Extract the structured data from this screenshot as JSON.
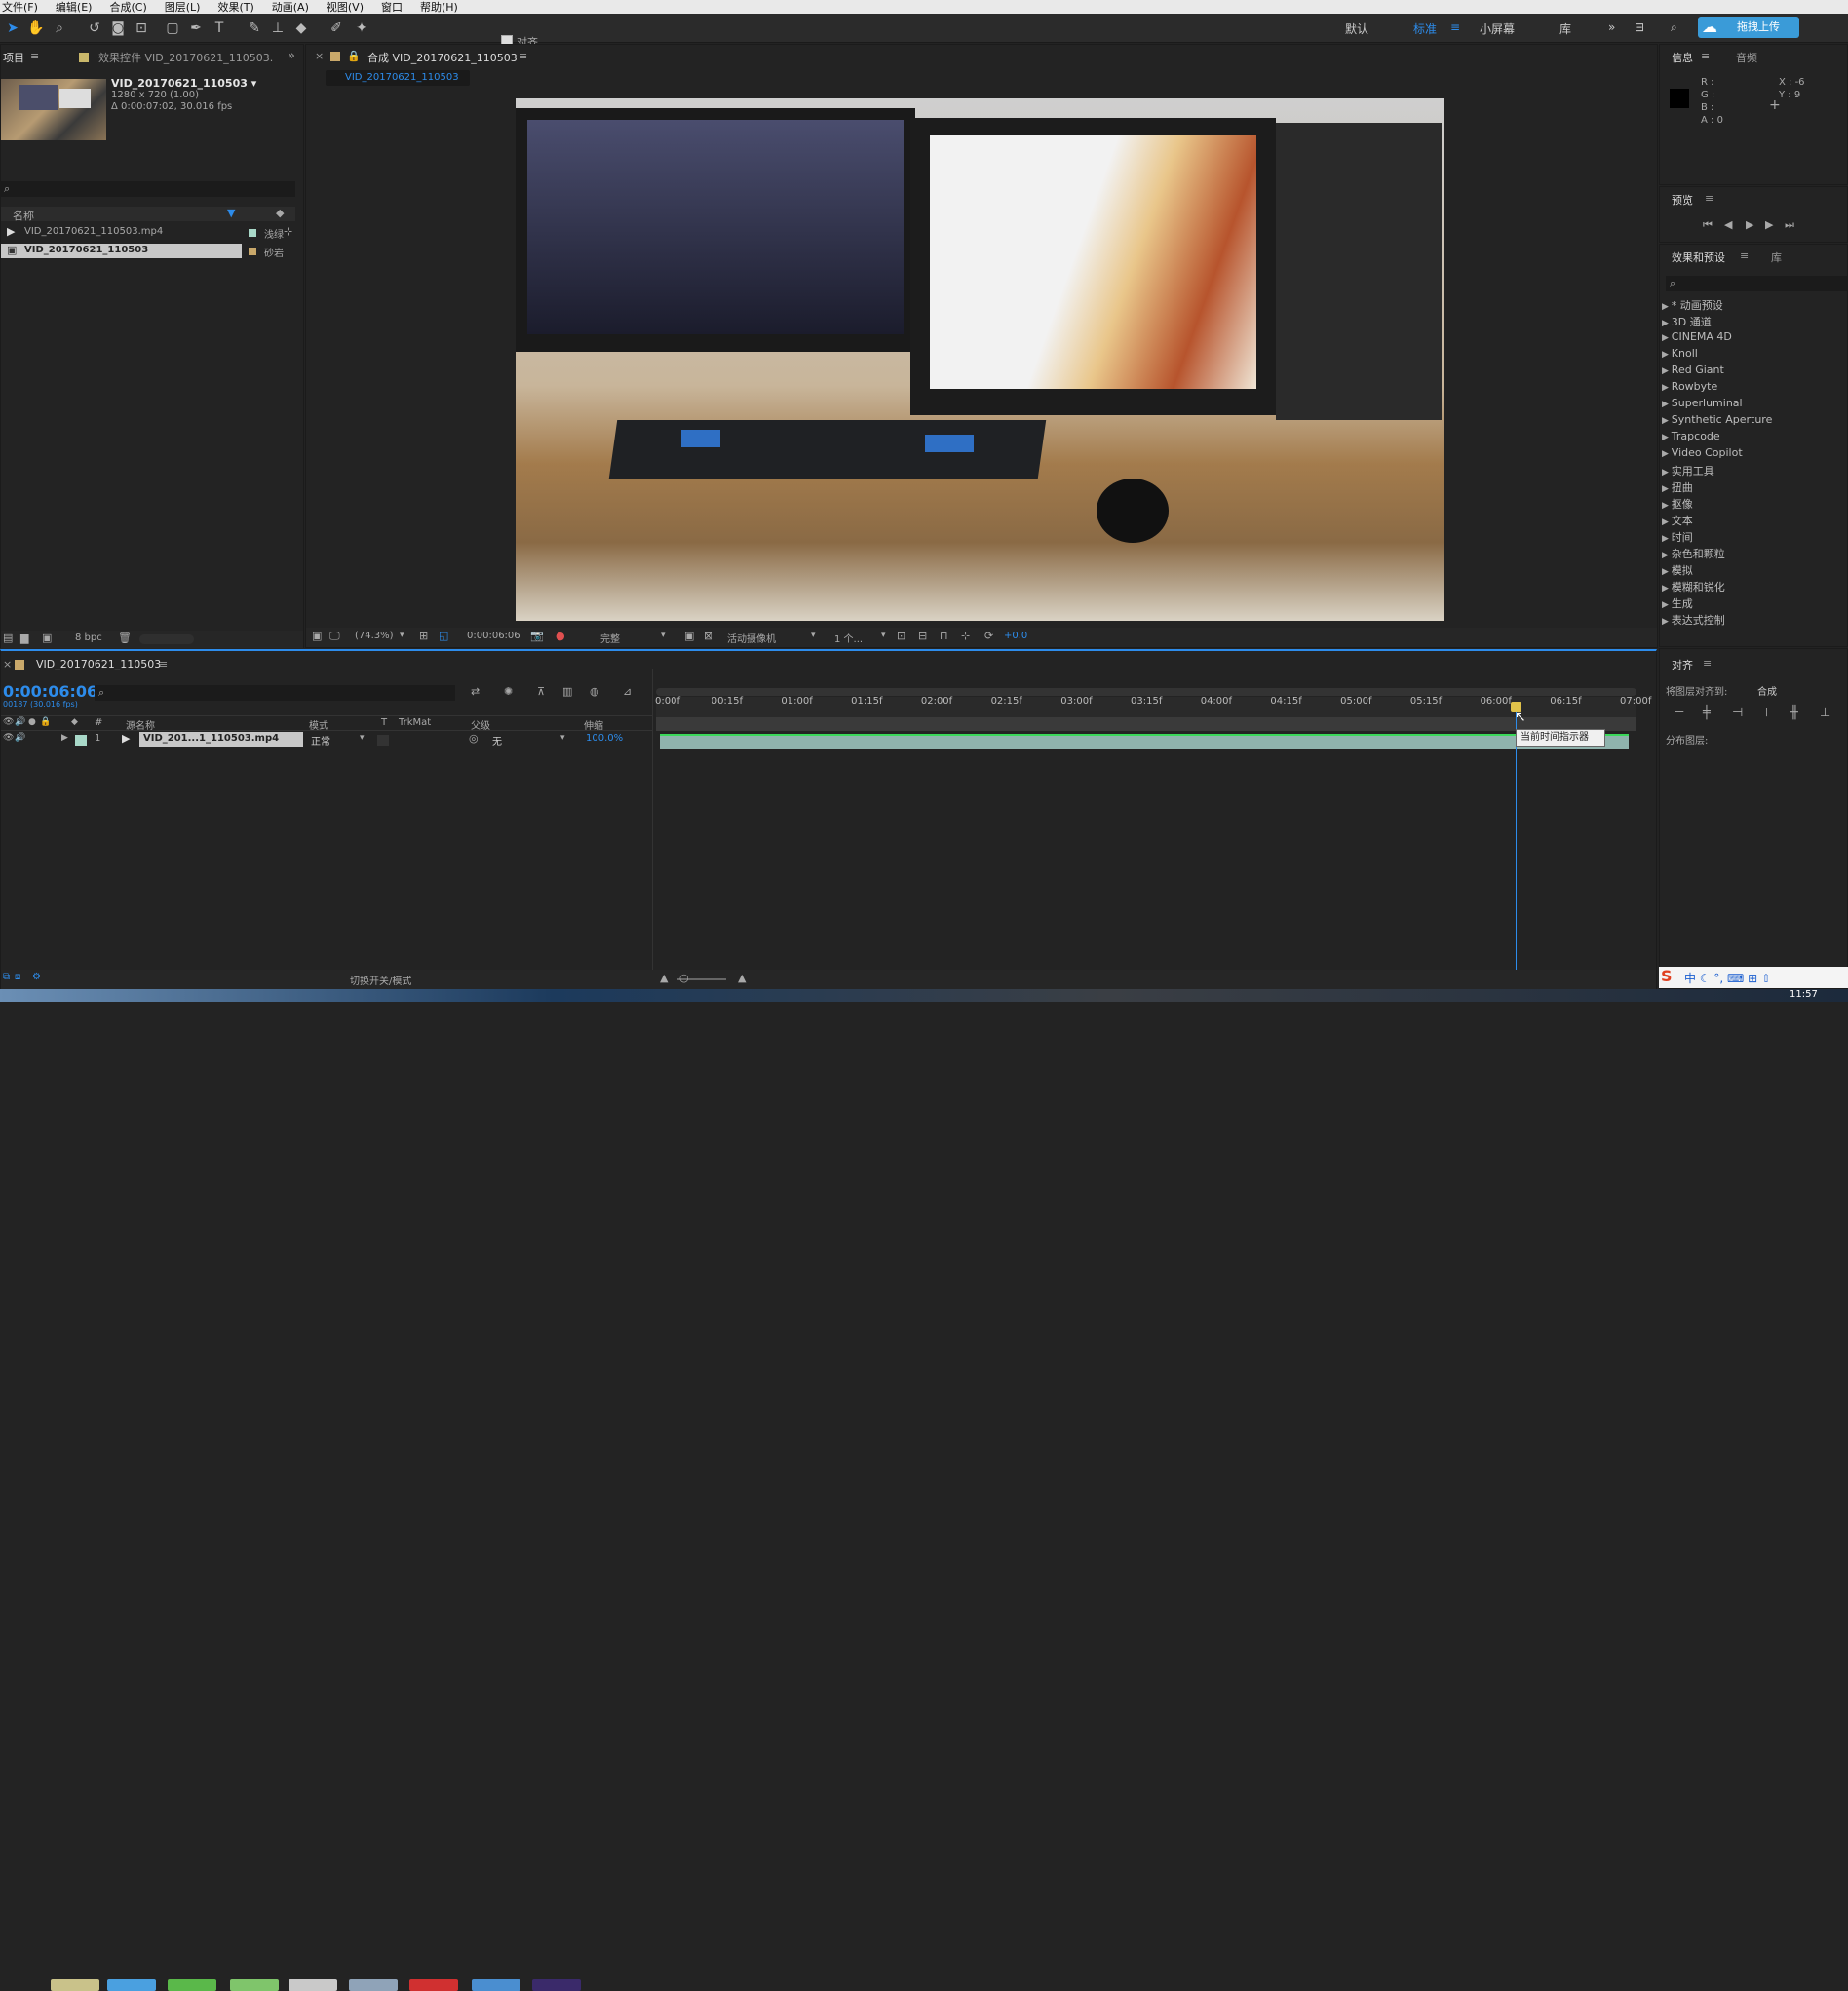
{
  "menu": [
    "文件(F)",
    "编辑(E)",
    "合成(C)",
    "图层(L)",
    "效果(T)",
    "动画(A)",
    "视图(V)",
    "窗口",
    "帮助(H)"
  ],
  "toolbar": {
    "snap_label": "对齐",
    "workspaces": [
      "默认",
      "标准",
      "小屏幕",
      "库"
    ],
    "active_workspace": "标准",
    "upload_label": "拖拽上传"
  },
  "project": {
    "tab_project": "项目",
    "tab_effects": "效果控件 VID_20170621_110503.",
    "item_name": "VID_20170621_110503 ▾",
    "item_res": "1280 x 720 (1.00)",
    "item_dur": "Δ 0:00:07:02, 30.016 fps",
    "col_name": "名称",
    "rows": [
      {
        "name": "VID_20170621_110503.mp4",
        "label": "浅绿"
      },
      {
        "name": "VID_20170621_110503",
        "label": "砂岩"
      }
    ],
    "bpc": "8 bpc"
  },
  "comp": {
    "tab": "合成 VID_20170621_110503",
    "subtab": "VID_20170621_110503",
    "zoom": "(74.3%)",
    "timecode": "0:00:06:06",
    "quality": "完整",
    "camera": "活动摄像机",
    "views": "1 个...",
    "exposure": "+0.0"
  },
  "info": {
    "tab": "信息",
    "tab2": "音频",
    "r": "R :",
    "g": "G :",
    "b": "B :",
    "a": "A : 0",
    "x": "X : -6",
    "y": "Y : 9"
  },
  "preview": {
    "tab": "预览"
  },
  "effects": {
    "tab": "效果和预设",
    "tab2": "库",
    "items": [
      "* 动画预设",
      "3D 通道",
      "CINEMA 4D",
      "Knoll",
      "Red Giant",
      "Rowbyte",
      "Superluminal",
      "Synthetic Aperture",
      "Trapcode",
      "Video Copilot",
      "实用工具",
      "扭曲",
      "抠像",
      "文本",
      "时间",
      "杂色和颗粒",
      "模拟",
      "模糊和锐化",
      "生成",
      "表达式控制"
    ]
  },
  "align": {
    "tab": "对齐",
    "align_to_label": "将图层对齐到:",
    "align_to": "合成",
    "distribute": "分布图层:"
  },
  "timeline": {
    "tab": "VID_20170621_110503",
    "timecode": "0:00:06:06",
    "frame": "00187 (30.016 fps)",
    "col_source": "源名称",
    "col_mode": "模式",
    "col_t": "T",
    "col_trkmat": "TrkMat",
    "col_parent": "父级",
    "col_stretch": "伸缩",
    "layer": {
      "num": "1",
      "name": "VID_201...1_110503.mp4",
      "mode": "正常",
      "parent": "无",
      "stretch": "100.0%"
    },
    "ticks": [
      "0:00f",
      "00:15f",
      "01:00f",
      "01:15f",
      "02:00f",
      "02:15f",
      "03:00f",
      "03:15f",
      "04:00f",
      "04:15f",
      "05:00f",
      "05:15f",
      "06:00f",
      "06:15f",
      "07:00f"
    ],
    "tooltip": "当前时间指示器",
    "footer": "切换开关/模式"
  },
  "taskbar": {
    "clock": "11:57"
  },
  "colors": {
    "accent": "#2d8ceb",
    "panel": "#232323",
    "bar": "#8fb3ad"
  }
}
